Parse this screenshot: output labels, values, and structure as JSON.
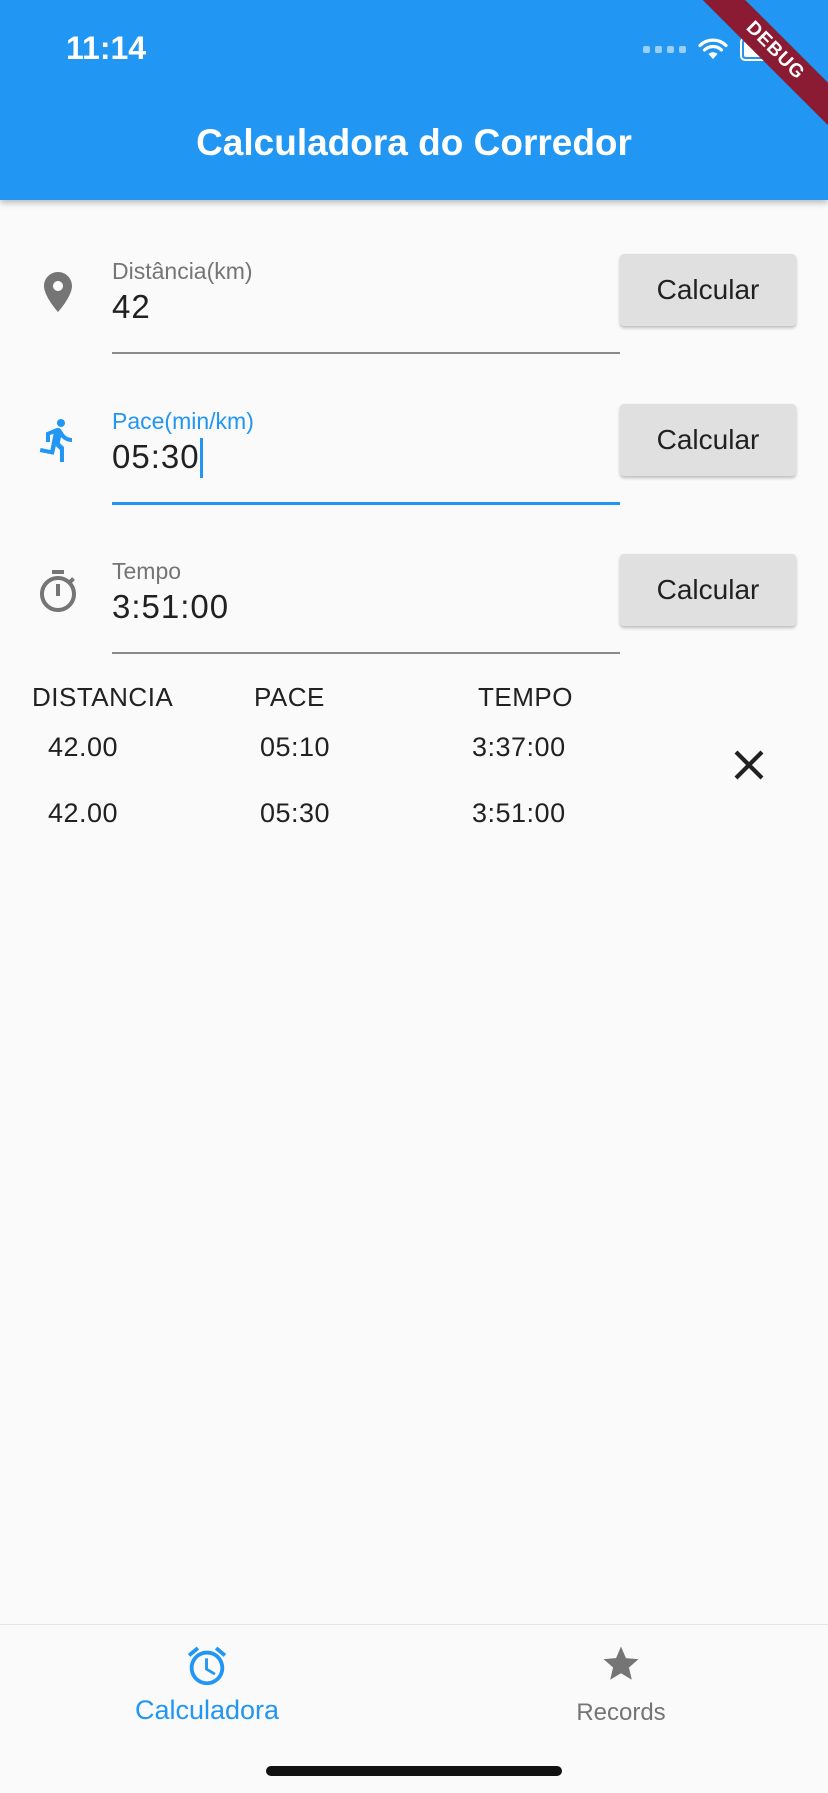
{
  "status_bar": {
    "time": "11:14",
    "debug_banner": "DEBUG"
  },
  "app_bar": {
    "title": "Calculadora do Corredor"
  },
  "fields": [
    {
      "label": "Distância(km)",
      "value": "42",
      "icon": "location-pin-icon",
      "button": "Calcular"
    },
    {
      "label": "Pace(min/km)",
      "value": "05:30",
      "icon": "running-person-icon",
      "button": "Calcular",
      "focused": true
    },
    {
      "label": "Tempo",
      "value": "3:51:00",
      "icon": "stopwatch-icon",
      "button": "Calcular"
    }
  ],
  "table": {
    "headers": [
      "DISTANCIA",
      "PACE",
      "TEMPO"
    ],
    "rows": [
      [
        "42.00",
        "05:10",
        "3:37:00"
      ],
      [
        "42.00",
        "05:30",
        "3:51:00"
      ]
    ]
  },
  "bottom_nav": {
    "items": [
      {
        "label": "Calculadora",
        "icon": "alarm-clock-icon",
        "active": true
      },
      {
        "label": "Records",
        "icon": "star-icon",
        "active": false
      }
    ]
  },
  "colors": {
    "primary": "#2196f3",
    "inactive": "#757575",
    "button_bg": "#e0e0e0",
    "debug_ribbon": "#8b1a33"
  }
}
